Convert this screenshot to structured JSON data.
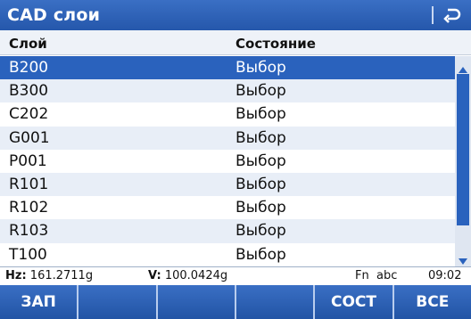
{
  "window": {
    "title": "CAD слои"
  },
  "columns": {
    "layer": "Слой",
    "state": "Состояние"
  },
  "rows": [
    {
      "layer": "B200",
      "state": "Выбор"
    },
    {
      "layer": "B300",
      "state": "Выбор"
    },
    {
      "layer": "C202",
      "state": "Выбор"
    },
    {
      "layer": "G001",
      "state": "Выбор"
    },
    {
      "layer": "P001",
      "state": "Выбор"
    },
    {
      "layer": "R101",
      "state": "Выбор"
    },
    {
      "layer": "R102",
      "state": "Выбор"
    },
    {
      "layer": "R103",
      "state": "Выбор"
    },
    {
      "layer": "T100",
      "state": "Выбор"
    }
  ],
  "status": {
    "hz_label": "Hz:",
    "hz_value": "161.2711g",
    "v_label": "V:",
    "v_value": "100.0424g",
    "mode": "Fn  abc",
    "time": "09:02"
  },
  "softkeys": [
    "ЗАП",
    "",
    "",
    "",
    "СОСТ",
    "ВСЕ"
  ],
  "colors": {
    "accent": "#2a62bd",
    "row_alt": "#e8eef7"
  }
}
